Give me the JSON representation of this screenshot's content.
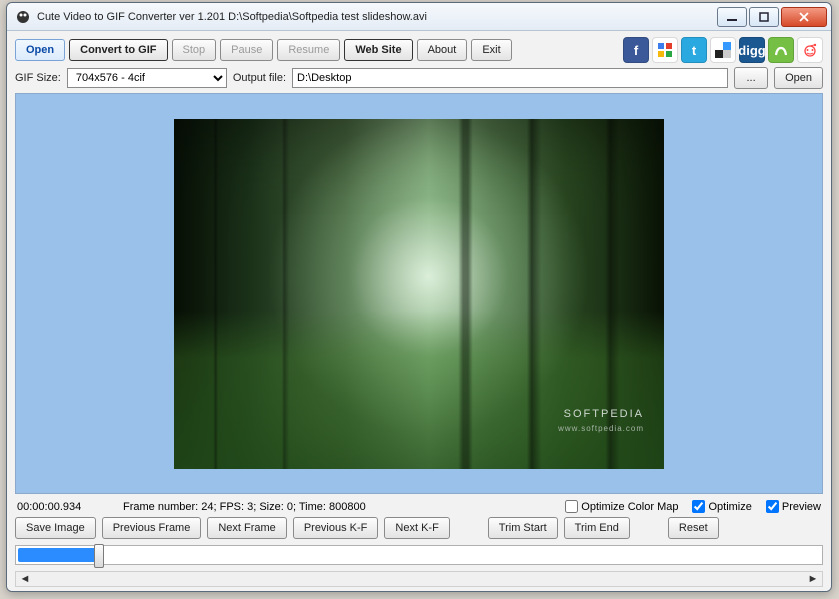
{
  "window": {
    "title": "Cute Video to GIF Converter ver 1.201  D:\\Softpedia\\Softpedia test slideshow.avi"
  },
  "toolbar": {
    "open": "Open",
    "convert": "Convert to GIF",
    "stop": "Stop",
    "pause": "Pause",
    "resume": "Resume",
    "website": "Web Site",
    "about": "About",
    "exit": "Exit"
  },
  "social": {
    "fb": "f",
    "gg": "",
    "tw": "t",
    "dl": "",
    "dg": "digg",
    "su": "",
    "rd": ""
  },
  "row2": {
    "gifsize_label": "GIF Size:",
    "gifsize_value": "704x576 - 4cif",
    "outputfile_label": "Output file:",
    "outputfile_value": "D:\\Desktop",
    "browse": "...",
    "open": "Open"
  },
  "watermark": {
    "main": "SOFTPEDIA",
    "sub": "www.softpedia.com"
  },
  "status": {
    "time": "00:00:00.934",
    "frameinfo": "Frame number: 24; FPS: 3; Size: 0; Time: 800800",
    "optimize_colormap": "Optimize Color Map",
    "optimize": "Optimize",
    "preview": "Preview",
    "optimize_colormap_checked": false,
    "optimize_checked": true,
    "preview_checked": true
  },
  "framebuttons": {
    "save_image": "Save Image",
    "prev_frame": "Previous Frame",
    "next_frame": "Next Frame",
    "prev_kf": "Previous K-F",
    "next_kf": "Next K-F",
    "trim_start": "Trim Start",
    "trim_end": "Trim End",
    "reset": "Reset"
  }
}
